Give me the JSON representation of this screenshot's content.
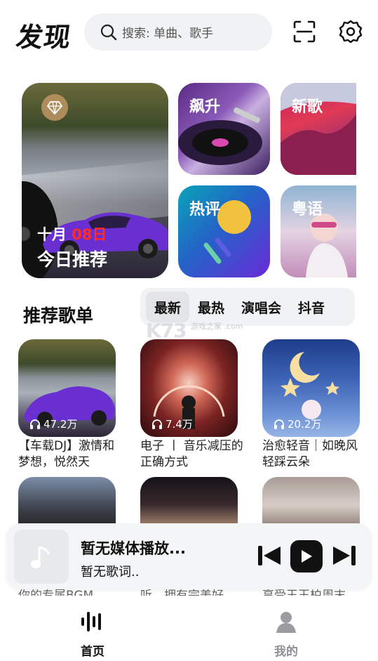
{
  "header": {
    "logo": "发现",
    "search_placeholder": "搜索: 单曲、歌手",
    "icons": [
      "search-icon",
      "scan-icon",
      "settings-icon"
    ]
  },
  "featured": {
    "hero": {
      "month": "十月",
      "day": "08日",
      "title": "今日推荐"
    },
    "tiles": [
      "飙升",
      "新歌",
      "热评",
      "粤语"
    ]
  },
  "recommend": {
    "title": "推荐歌单",
    "tabs": [
      "最新",
      "最热",
      "演唱会",
      "抖音"
    ],
    "active_tab": "最新",
    "watermark": "K73",
    "watermark_sub": "游戏之家 .com",
    "cards": [
      {
        "plays": "47.2万",
        "name": "【车载DJ】激情和梦想，悦然天"
      },
      {
        "plays": "7.4万",
        "name": "电子 丨 音乐减压的正确方式"
      },
      {
        "plays": "20.2万",
        "name": "治愈轻音｜如晚风轻踩云朵"
      }
    ],
    "partial_names": [
      "你的专属BGM",
      "听，拥有完美好",
      "享受王玉柏周末"
    ]
  },
  "player": {
    "title": "暂无媒体播放...",
    "lyric": "暂无歌词.."
  },
  "bottom_nav": [
    {
      "label": "首页",
      "active": true,
      "icon": "waveform-icon"
    },
    {
      "label": "我的",
      "active": false,
      "icon": "user-icon"
    }
  ],
  "colors": {
    "accent": "#111111",
    "inactive": "#8e9095",
    "date_red": "#ff2a2a"
  }
}
